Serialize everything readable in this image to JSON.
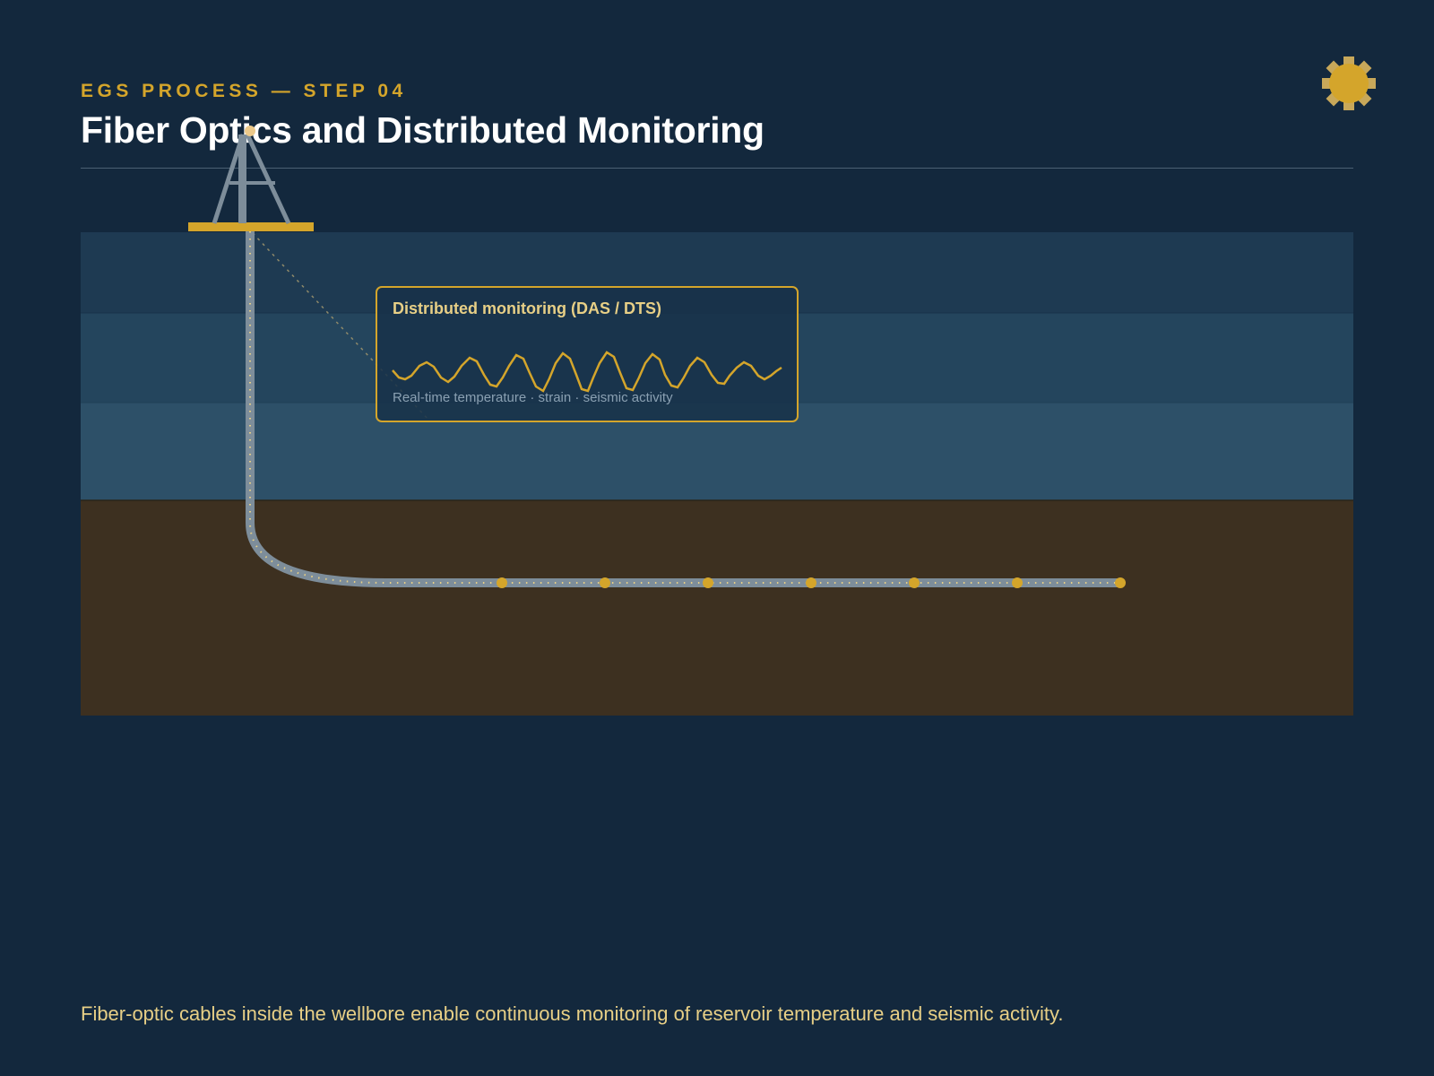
{
  "header": {
    "kicker": "EGS PROCESS — STEP 04",
    "title": "Fiber Optics and Distributed Monitoring"
  },
  "callout": {
    "title": "Distributed monitoring (DAS / DTS)",
    "subtitle": "Real-time temperature · strain · seismic activity"
  },
  "caption": "Fiber-optic cables inside the wellbore enable continuous monitoring of reservoir temperature and seismic activity.",
  "icons": {
    "logo": "gear-icon",
    "rig": "drilling-rig-icon",
    "waveform": "waveform-icon"
  },
  "colors": {
    "background": "#13283d",
    "accent": "#d4a52b",
    "strata_1": "#1e3a52",
    "strata_2": "#24455d",
    "strata_3": "#2d5068",
    "reservoir": "#3d3020",
    "cable": "#7d8d9a"
  },
  "sensor_count": 7
}
